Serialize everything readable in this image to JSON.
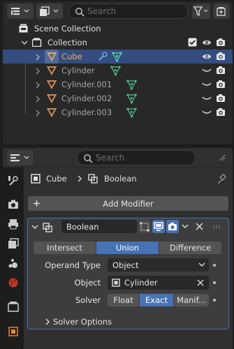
{
  "outliner": {
    "search_placeholder": "Search",
    "scene_collection": "Scene Collection",
    "collection": "Collection",
    "items": [
      {
        "name": "Cube",
        "selected": true
      },
      {
        "name": "Cylinder",
        "selected": false
      },
      {
        "name": "Cylinder.001",
        "selected": false
      },
      {
        "name": "Cylinder.002",
        "selected": false
      },
      {
        "name": "Cylinder.003",
        "selected": false
      }
    ]
  },
  "properties": {
    "search_placeholder": "Search",
    "breadcrumb": {
      "object": "Cube",
      "modifier": "Boolean"
    },
    "add_modifier_label": "Add Modifier",
    "modifier": {
      "name": "Boolean",
      "operations": [
        "Intersect",
        "Union",
        "Difference"
      ],
      "active_operation": "Union",
      "operand_type_label": "Operand Type",
      "operand_type_value": "Object",
      "object_label": "Object",
      "object_value": "Cylinder",
      "solver_label": "Solver",
      "solvers": [
        "Float",
        "Exact",
        "Manif..."
      ],
      "active_solver": "Exact",
      "solver_options_label": "Solver Options"
    }
  },
  "colors": {
    "selection": "#334d80",
    "active_button": "#4772b3",
    "mesh_orange": "#e0a36e",
    "mesh_data_green": "#5bd6a0"
  }
}
